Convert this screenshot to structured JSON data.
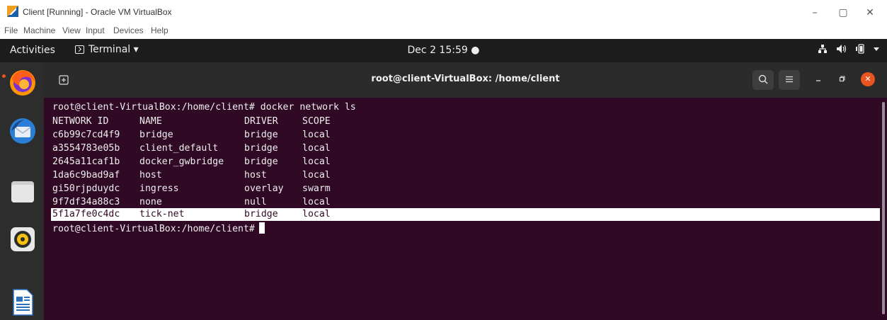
{
  "virtualbox": {
    "title": "Client [Running] - Oracle VM VirtualBox",
    "menu": [
      "File",
      "Machine",
      "View",
      "Input",
      "Devices",
      "Help"
    ],
    "controls": {
      "minimize": "–",
      "restore": "▢",
      "close": "✕"
    }
  },
  "topbar": {
    "activities": "Activities",
    "app_menu": "Terminal ▾",
    "clock": "Dec 2  15:59  ●",
    "tray": [
      "network-icon",
      "volume-icon",
      "battery-icon",
      "chevron-down-icon"
    ]
  },
  "dock": {
    "items": [
      "firefox-icon",
      "thunderbird-icon",
      "files-icon",
      "rhythmbox-icon",
      "libreoffice-writer-icon"
    ]
  },
  "terminal": {
    "title": "root@client-VirtualBox: /home/client",
    "command_prompt": "root@client-VirtualBox:/home/client# docker network ls",
    "table": {
      "headers": [
        "NETWORK ID",
        "NAME",
        "DRIVER",
        "SCOPE"
      ],
      "rows": [
        [
          "c6b99c7cd4f9",
          "bridge",
          "bridge",
          "local"
        ],
        [
          "a3554783e05b",
          "client_default",
          "bridge",
          "local"
        ],
        [
          "2645a11caf1b",
          "docker_gwbridge",
          "bridge",
          "local"
        ],
        [
          "1da6c9bad9af",
          "host",
          "host",
          "local"
        ],
        [
          "gi50rjpduydc",
          "ingress",
          "overlay",
          "swarm"
        ],
        [
          "9f7df34a88c3",
          "none",
          "null",
          "local"
        ],
        [
          "5f1a7fe0c4dc",
          "tick-net",
          "bridge",
          "local"
        ]
      ],
      "highlighted_row": 6
    },
    "final_prompt": "root@client-VirtualBox:/home/client#"
  },
  "colors": {
    "terminal_bg": "#300a24",
    "ubuntu_orange": "#e95420",
    "highlight": "#ffffff"
  }
}
